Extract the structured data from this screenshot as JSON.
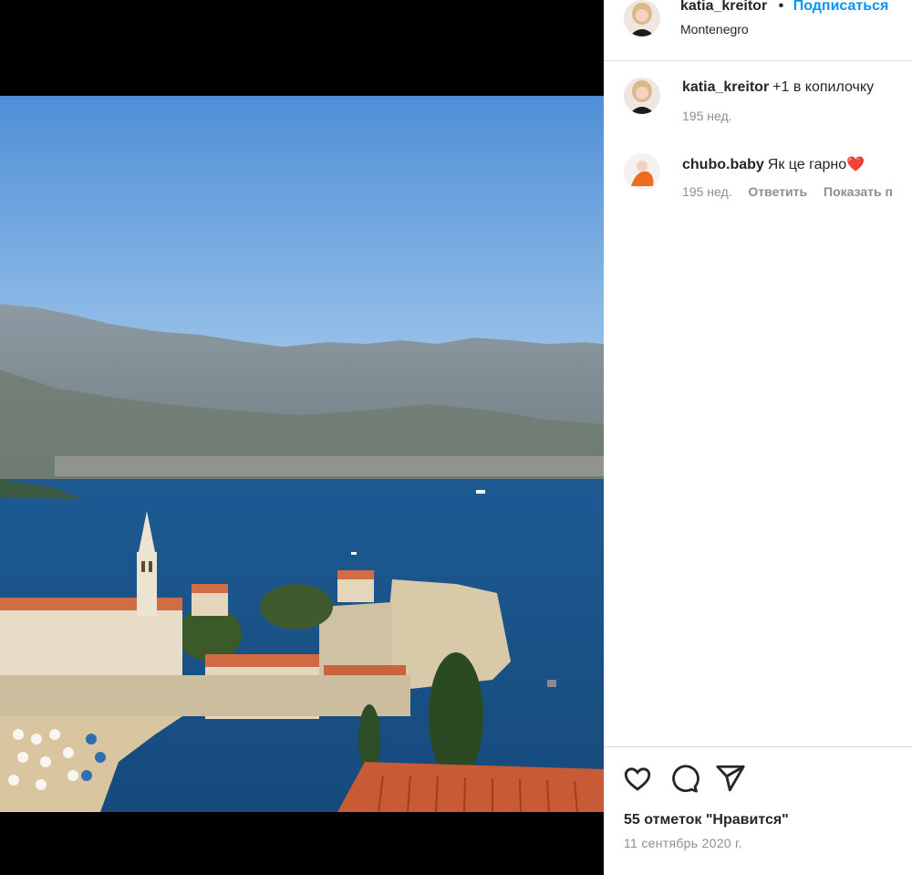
{
  "post": {
    "author": "katia_kreitor",
    "separator": "•",
    "follow_label": "Подписаться",
    "location": "Montenegro"
  },
  "comments": [
    {
      "username": "katia_kreitor",
      "text": "+1 в копилочку",
      "time": "195 нед."
    },
    {
      "username": "chubo.baby",
      "text": "Як це гарно",
      "emoji": "❤️",
      "time": "195 нед.",
      "reply_label": "Ответить",
      "more_label": "Показать п"
    }
  ],
  "actions": {
    "like_icon": "heart-outline-icon",
    "comment_icon": "comment-bubble-icon",
    "share_icon": "paper-plane-icon"
  },
  "likes_text": "55 отметок \"Нравится\"",
  "date_text": "11 сентябрь 2020 г.",
  "colors": {
    "follow": "#0095f6",
    "text": "#262626",
    "muted": "#8e8e8e",
    "divider": "#dbdbdb"
  }
}
